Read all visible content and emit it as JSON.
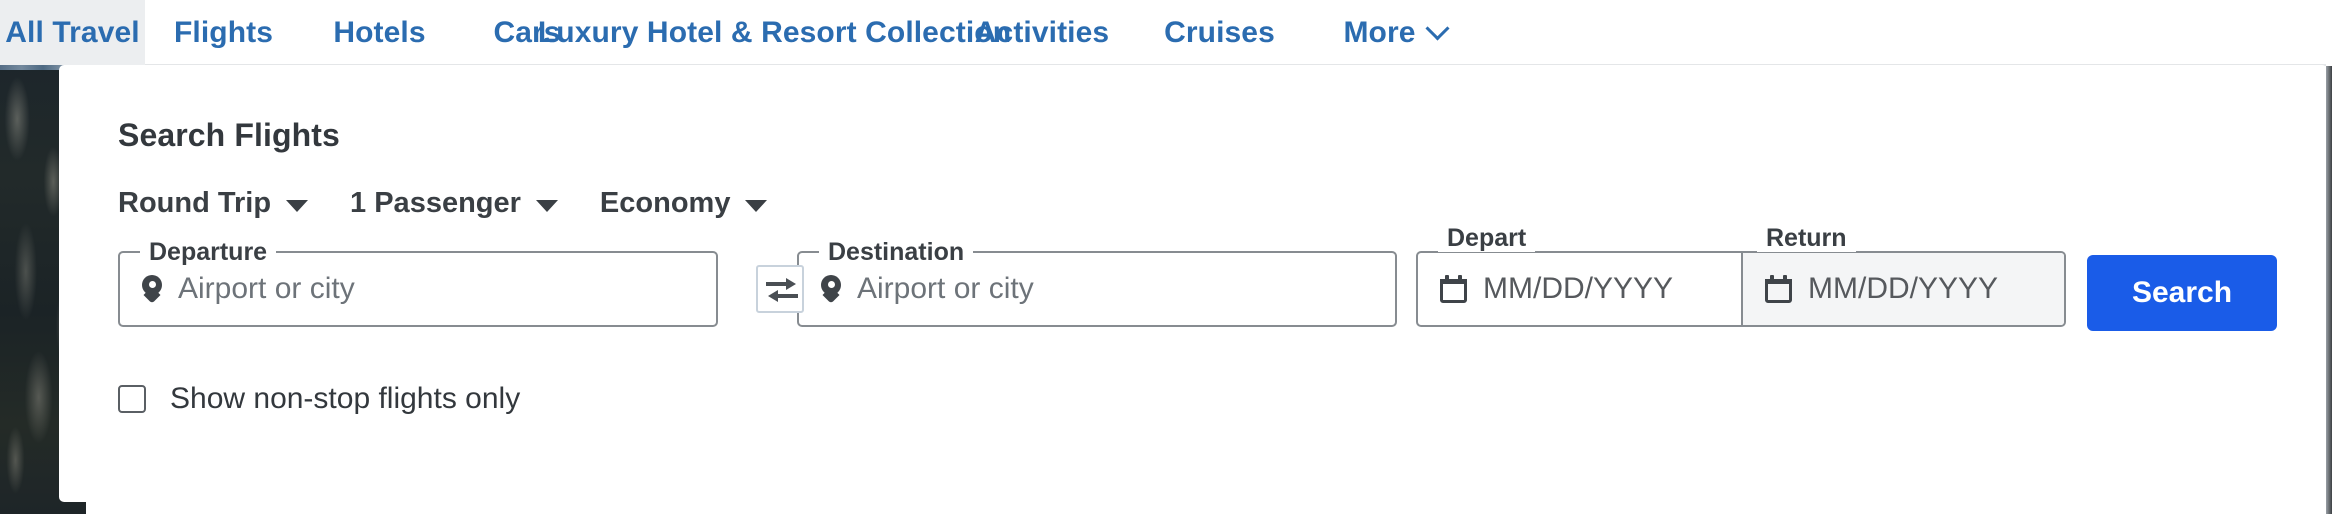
{
  "nav": {
    "tabs": [
      {
        "label": "All Travel",
        "active": true,
        "caret": false
      },
      {
        "label": "Flights",
        "active": false,
        "caret": false
      },
      {
        "label": "Hotels",
        "active": false,
        "caret": false
      },
      {
        "label": "Cars",
        "active": false,
        "caret": false
      },
      {
        "label": "Luxury Hotel & Resort Collection",
        "active": false,
        "caret": false
      },
      {
        "label": "Activities",
        "active": false,
        "caret": false
      },
      {
        "label": "Cruises",
        "active": false,
        "caret": false
      },
      {
        "label": "More",
        "active": false,
        "caret": true
      }
    ]
  },
  "card": {
    "title": "Search Flights"
  },
  "options": {
    "trip_type": "Round Trip",
    "passengers": "1 Passenger",
    "cabin_class": "Economy"
  },
  "fields": {
    "departure": {
      "label": "Departure",
      "value": "",
      "placeholder": "Airport or city",
      "icon": "map-pin-icon"
    },
    "destination": {
      "label": "Destination",
      "value": "",
      "placeholder": "Airport or city",
      "icon": "map-pin-icon"
    },
    "depart_date": {
      "label": "Depart",
      "value": "",
      "placeholder": "MM/DD/YYYY",
      "icon": "calendar-icon"
    },
    "return_date": {
      "label": "Return",
      "value": "",
      "placeholder": "MM/DD/YYYY",
      "icon": "calendar-icon"
    },
    "swap": {
      "icon": "swap-arrows-icon"
    }
  },
  "actions": {
    "search_label": "Search"
  },
  "checkbox": {
    "label": "Show non-stop flights only",
    "checked": false
  },
  "colors": {
    "tab_link": "#2b6cb0",
    "tab_active_bg": "#eceef0",
    "search_button": "#1a5ce8",
    "field_border": "#878c91",
    "return_fill": "#f4f5f6",
    "text_dark": "#33383d",
    "placeholder": "#6d7379"
  }
}
